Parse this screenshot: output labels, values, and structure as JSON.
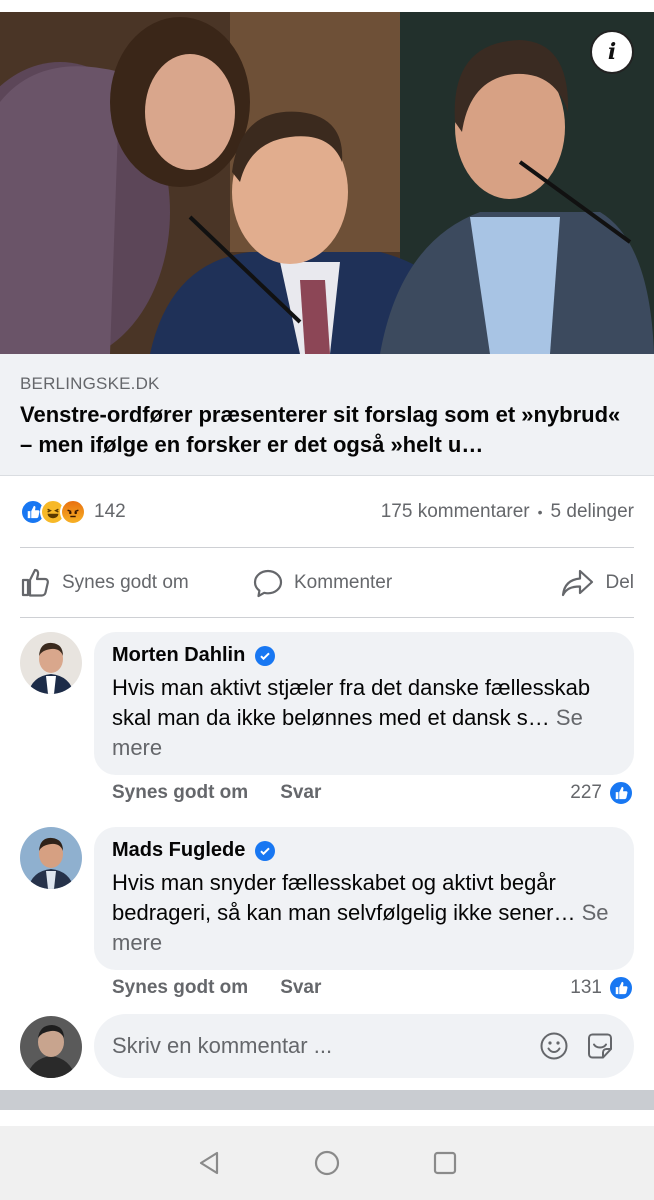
{
  "post": {
    "link_domain": "BERLINGSKE.DK",
    "link_title": "Venstre-ordfører præsenterer sit forslag som et »nybrud« – men ifølge en forsker er det også »helt u…",
    "info_icon": "info-icon"
  },
  "stats": {
    "reaction_icons": [
      "like-reaction-icon",
      "haha-reaction-icon",
      "angry-reaction-icon"
    ],
    "reaction_count": "142",
    "comments": "175 kommentarer",
    "separator": "•",
    "shares": "5 delinger"
  },
  "actions": {
    "like": "Synes godt om",
    "comment": "Kommenter",
    "share": "Del"
  },
  "comments": [
    {
      "name": "Morten Dahlin",
      "text": "Hvis man aktivt stjæler fra det danske fællesskab skal man da ikke belønnes med et dansk s…",
      "see_more": "Se mere",
      "like_label": "Synes godt om",
      "reply_label": "Svar",
      "likes": "227"
    },
    {
      "name": "Mads Fuglede",
      "text": "Hvis man snyder fællesskabet og aktivt begår bedrageri, så kan man selvfølgelig ikke sener…",
      "see_more": "Se mere",
      "like_label": "Synes godt om",
      "reply_label": "Svar",
      "likes": "131"
    }
  ],
  "composer": {
    "placeholder": "Skriv en kommentar ...",
    "icons": [
      "emoji-icon",
      "sticker-icon"
    ]
  },
  "colors": {
    "accent": "#1877f2",
    "secondary_text": "#65676b",
    "bubble_bg": "#f0f2f5"
  }
}
